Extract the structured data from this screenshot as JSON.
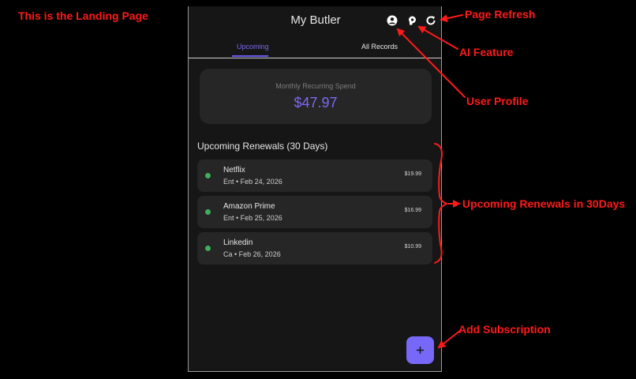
{
  "app": {
    "title": "My Butler",
    "tabs": [
      {
        "label": "Upcoming",
        "active": true
      },
      {
        "label": "All Records",
        "active": false
      }
    ],
    "header_icons": [
      "user-profile-icon",
      "ai-feature-icon",
      "refresh-icon"
    ]
  },
  "summary": {
    "label": "Monthly Recurring Spend",
    "amount": "$47.97"
  },
  "renewals": {
    "title": "Upcoming Renewals (30 Days)",
    "items": [
      {
        "name": "Netflix",
        "meta": "Ent • Feb 24, 2026",
        "price": "$19.99"
      },
      {
        "name": "Amazon Prime",
        "meta": "Ent • Feb 25, 2026",
        "price": "$16.99"
      },
      {
        "name": "Linkedin",
        "meta": "Ca • Feb 26, 2026",
        "price": "$10.99"
      }
    ]
  },
  "fab": {
    "label": "+"
  },
  "annotations": {
    "landing": "This is the Landing Page",
    "refresh": "Page Refresh",
    "ai": "AI Feature",
    "profile": "User Profile",
    "renewals": "Upcoming Renewals in 30Days",
    "add": "Add Subscription"
  },
  "colors": {
    "accent": "#7768f8",
    "annotation": "#ff1a1a",
    "status_dot": "#3fae5a",
    "background": "#161616"
  }
}
